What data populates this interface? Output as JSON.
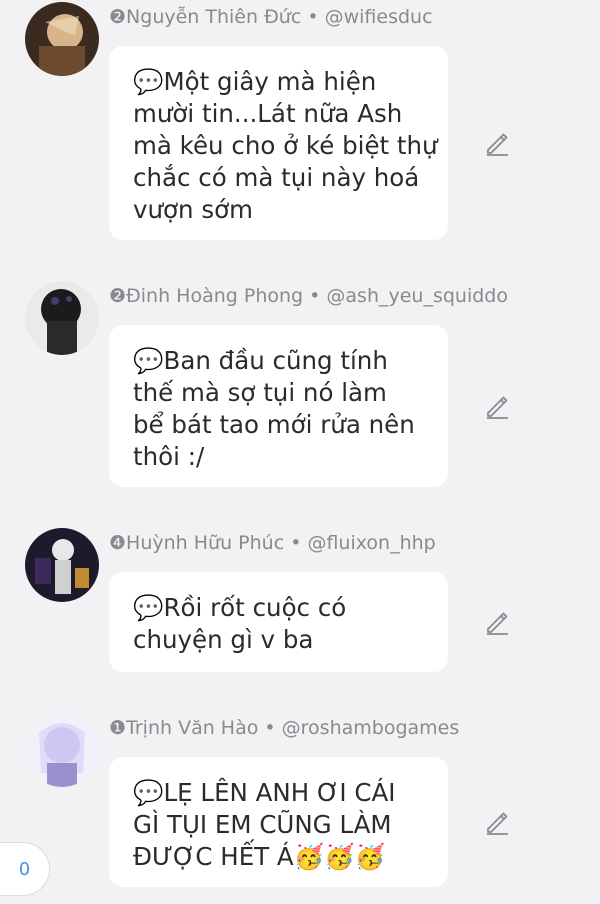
{
  "messages": [
    {
      "rank_badge": "❷",
      "name": "Nguyễn Thiên Đức",
      "separator": " • ",
      "handle": "@wifiesduc",
      "lines": [
        "💬Một giây mà hiện",
        "mười tin...Lát nữa Ash",
        "mà kêu cho ở ké biệt thự",
        "chắc có mà tụi này hoá",
        "vượn sớm"
      ]
    },
    {
      "rank_badge": "❷",
      "name": "Đinh Hoàng Phong",
      "separator": " • ",
      "handle": "@ash_yeu_squiddo",
      "lines": [
        "💬Ban đầu cũng tính",
        "thế mà sợ tụi nó làm",
        "bể bát tao mới rửa nên",
        "thôi :/"
      ]
    },
    {
      "rank_badge": "❹",
      "name": "Huỳnh Hữu Phúc",
      "separator": " • ",
      "handle": "@fluixon_hhp",
      "lines": [
        "💬Rồi rốt cuộc có",
        "chuyện gì v ba"
      ]
    },
    {
      "rank_badge": "❶",
      "name": "Trịnh Văn Hào",
      "separator": " • ",
      "handle": "@roshambogames",
      "lines": [
        "💬LẸ LÊN ANH ƠI CÁI",
        "GÌ TỤI EM CŨNG LÀM",
        "ĐƯỢC HẾT Á🥳🥳🥳"
      ]
    }
  ],
  "counter": {
    "value": "0"
  },
  "colors": {
    "background": "#f2f2f4",
    "bubble": "#ffffff",
    "meta": "#8a8a8e",
    "accent": "#4a90e2"
  },
  "icons": {
    "edit": "pencil-icon"
  }
}
